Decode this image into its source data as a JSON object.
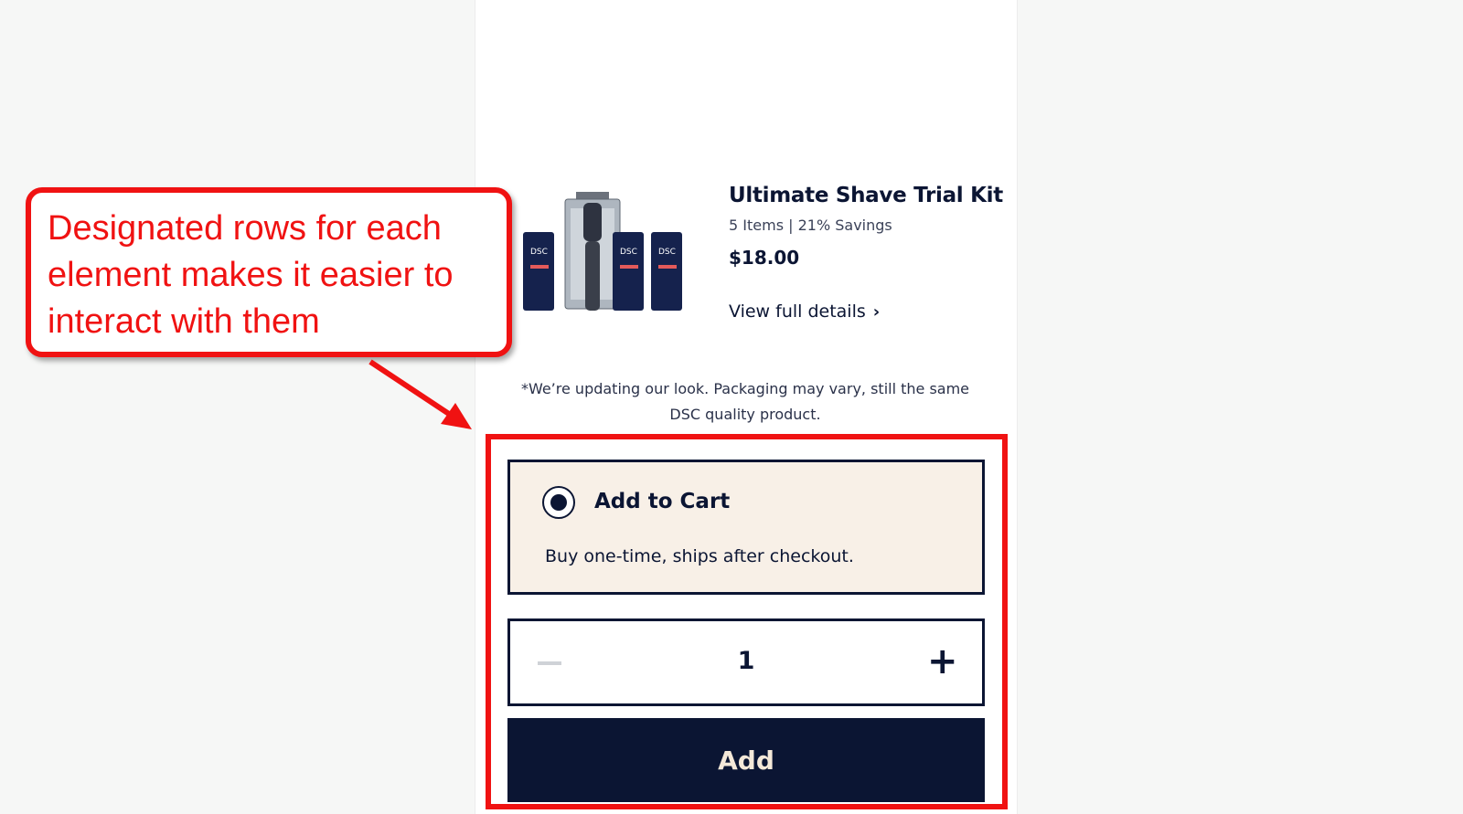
{
  "product": {
    "title": "Ultimate Shave Trial Kit",
    "subtitle": "5 Items | 21% Savings",
    "price": "$18.00",
    "details_link": "View full details",
    "image_icon": "product-kit-image",
    "tube_label": "DSC"
  },
  "notice": {
    "line1": "*We’re updating our look. Packaging may vary, still the same",
    "line2": "DSC quality product."
  },
  "purchase_option": {
    "label": "Add to Cart",
    "description": "Buy one-time, ships after checkout.",
    "selected": true
  },
  "quantity": {
    "value": "1",
    "minus_icon": "minus-icon",
    "plus_icon": "plus-icon",
    "plus_symbol": "+"
  },
  "add_button": {
    "label": "Add"
  },
  "annotation": {
    "line1": "Designated rows for each",
    "line2": "element makes it easier to",
    "line3": "interact with them",
    "color": "#f01212"
  },
  "colors": {
    "navy": "#0b1533",
    "cream": "#f8f0e7",
    "button_text": "#f4e8d8"
  }
}
